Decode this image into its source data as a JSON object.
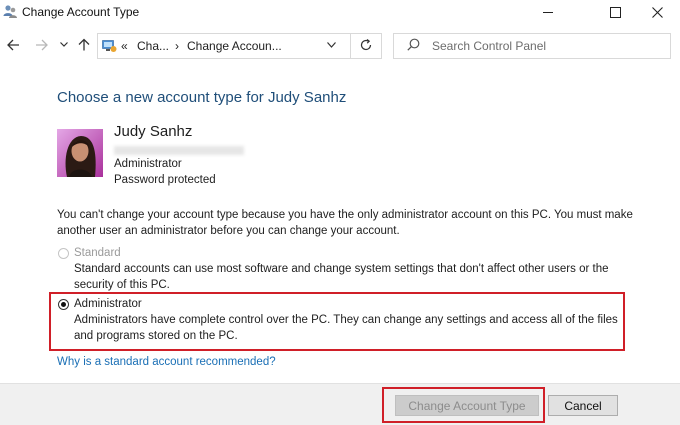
{
  "window": {
    "title": "Change Account Type",
    "minimize_icon": "minimize-icon",
    "maximize_icon": "maximize-icon",
    "close_icon": "close-icon"
  },
  "nav": {
    "back_icon": "arrow-left-icon",
    "forward_icon": "arrow-right-icon",
    "recent_icon": "chevron-down-icon",
    "up_icon": "arrow-up-icon",
    "breadcrumb": [
      "Cha...",
      "Change Accoun..."
    ],
    "refresh_icon": "refresh-icon",
    "search_placeholder": "Search Control Panel"
  },
  "content": {
    "heading": "Choose a new account type for Judy Sanhz",
    "user": {
      "name": "Judy Sanhz",
      "role": "Administrator",
      "status": "Password protected"
    },
    "warning": "You can't change your account type because you have the only administrator account on this PC. You must make another user an administrator before you can change your account.",
    "options": [
      {
        "label": "Standard",
        "description": "Standard accounts can use most software and change system settings that don't affect other users or the security of this PC.",
        "selected": false,
        "enabled": false
      },
      {
        "label": "Administrator",
        "description": "Administrators have complete control over the PC. They can change any settings and access all of the files and programs stored on the PC.",
        "selected": true,
        "enabled": true
      }
    ],
    "help_link": "Why is a standard account recommended?"
  },
  "footer": {
    "primary_button": "Change Account Type",
    "cancel_button": "Cancel"
  },
  "colors": {
    "heading": "#1f4e79",
    "link": "#1a6fb5",
    "highlight": "#d01f28"
  }
}
